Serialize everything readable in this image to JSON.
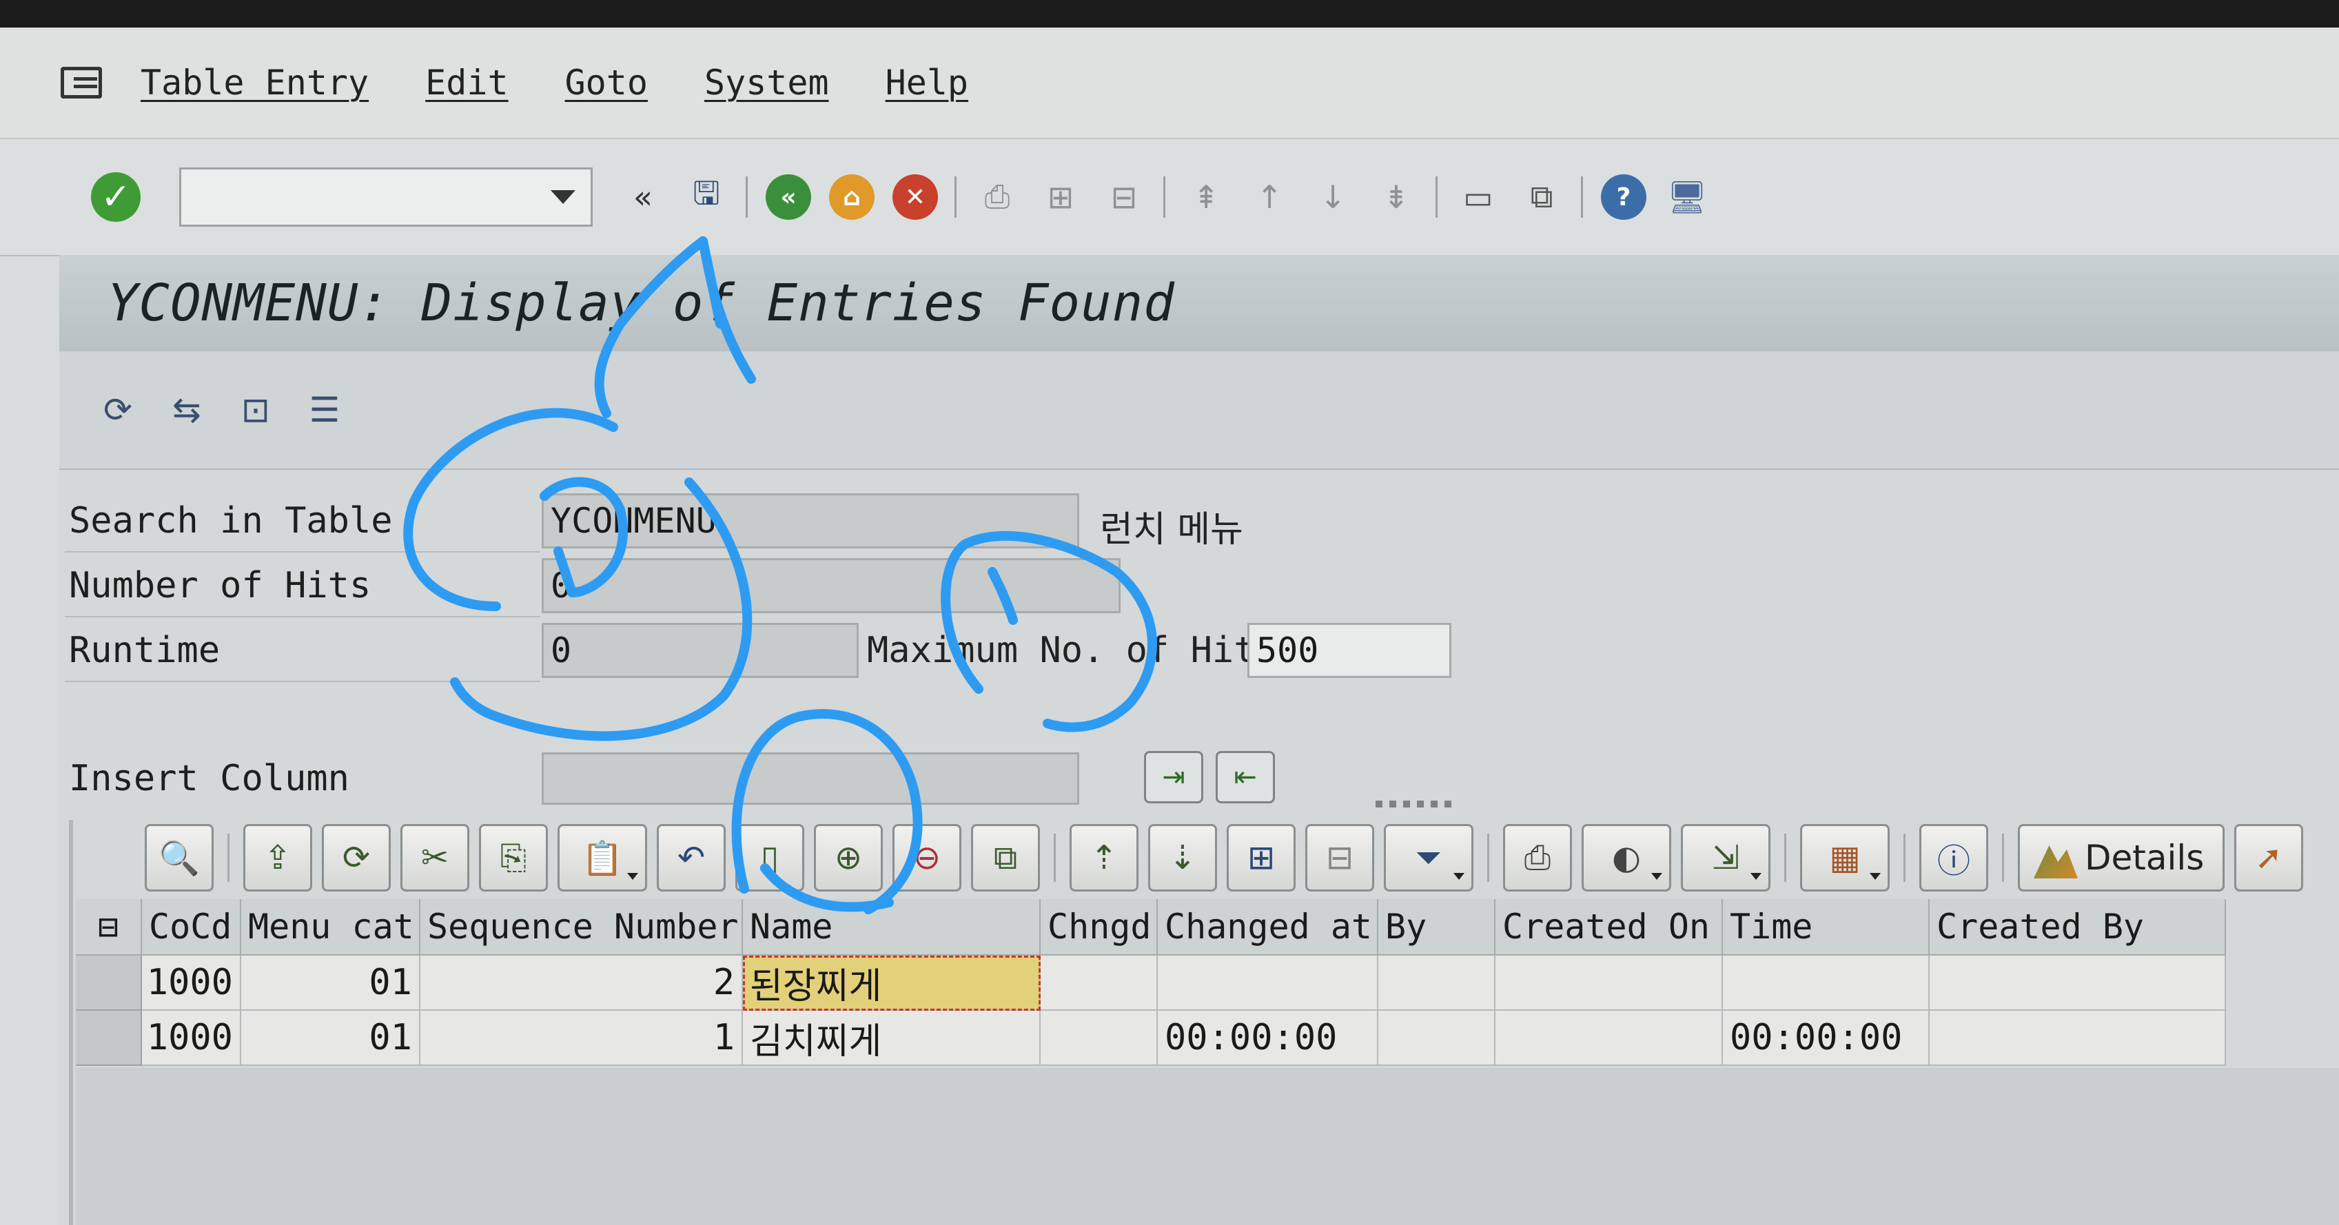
{
  "menu": {
    "items": [
      "Table Entry",
      "Edit",
      "Goto",
      "System",
      "Help"
    ]
  },
  "toolbar": {
    "command_value": "",
    "back_label": "«"
  },
  "title": "YCONMENU: Display of Entries Found",
  "form": {
    "search_in_table_label": "Search in Table",
    "search_in_table_value": "YCONMENU",
    "search_in_table_desc": "런치 메뉴",
    "number_of_hits_label": "Number of Hits",
    "number_of_hits_value": "0",
    "runtime_label": "Runtime",
    "runtime_value": "0",
    "max_hits_label": "Maximum No. of Hits",
    "max_hits_value": "500",
    "insert_column_label": "Insert Column",
    "insert_column_value": ""
  },
  "alv": {
    "details_label": "Details"
  },
  "grid": {
    "columns": [
      "CoCd",
      "Menu cat",
      "Sequence Number",
      "Name",
      "Chngd",
      "Changed at",
      "By",
      "Created On",
      "Time",
      "Created By"
    ],
    "rows": [
      {
        "cocd": "1000",
        "menu_cat": "01",
        "seq": "2",
        "name": "된장찌게",
        "chngd": "",
        "changed_at": "",
        "by": "",
        "created_on": "",
        "time": "",
        "created_by": ""
      },
      {
        "cocd": "1000",
        "menu_cat": "01",
        "seq": "1",
        "name": "김치찌게",
        "chngd": "",
        "changed_at": "00:00:00",
        "by": "",
        "created_on": "",
        "time": "00:00:00",
        "created_by": ""
      }
    ]
  },
  "colors": {
    "screen_bg": "#d9dcdc",
    "title_bg": "#c4cbce",
    "active_cell": "#e3d07a",
    "annotation": "#2e9bf2"
  }
}
